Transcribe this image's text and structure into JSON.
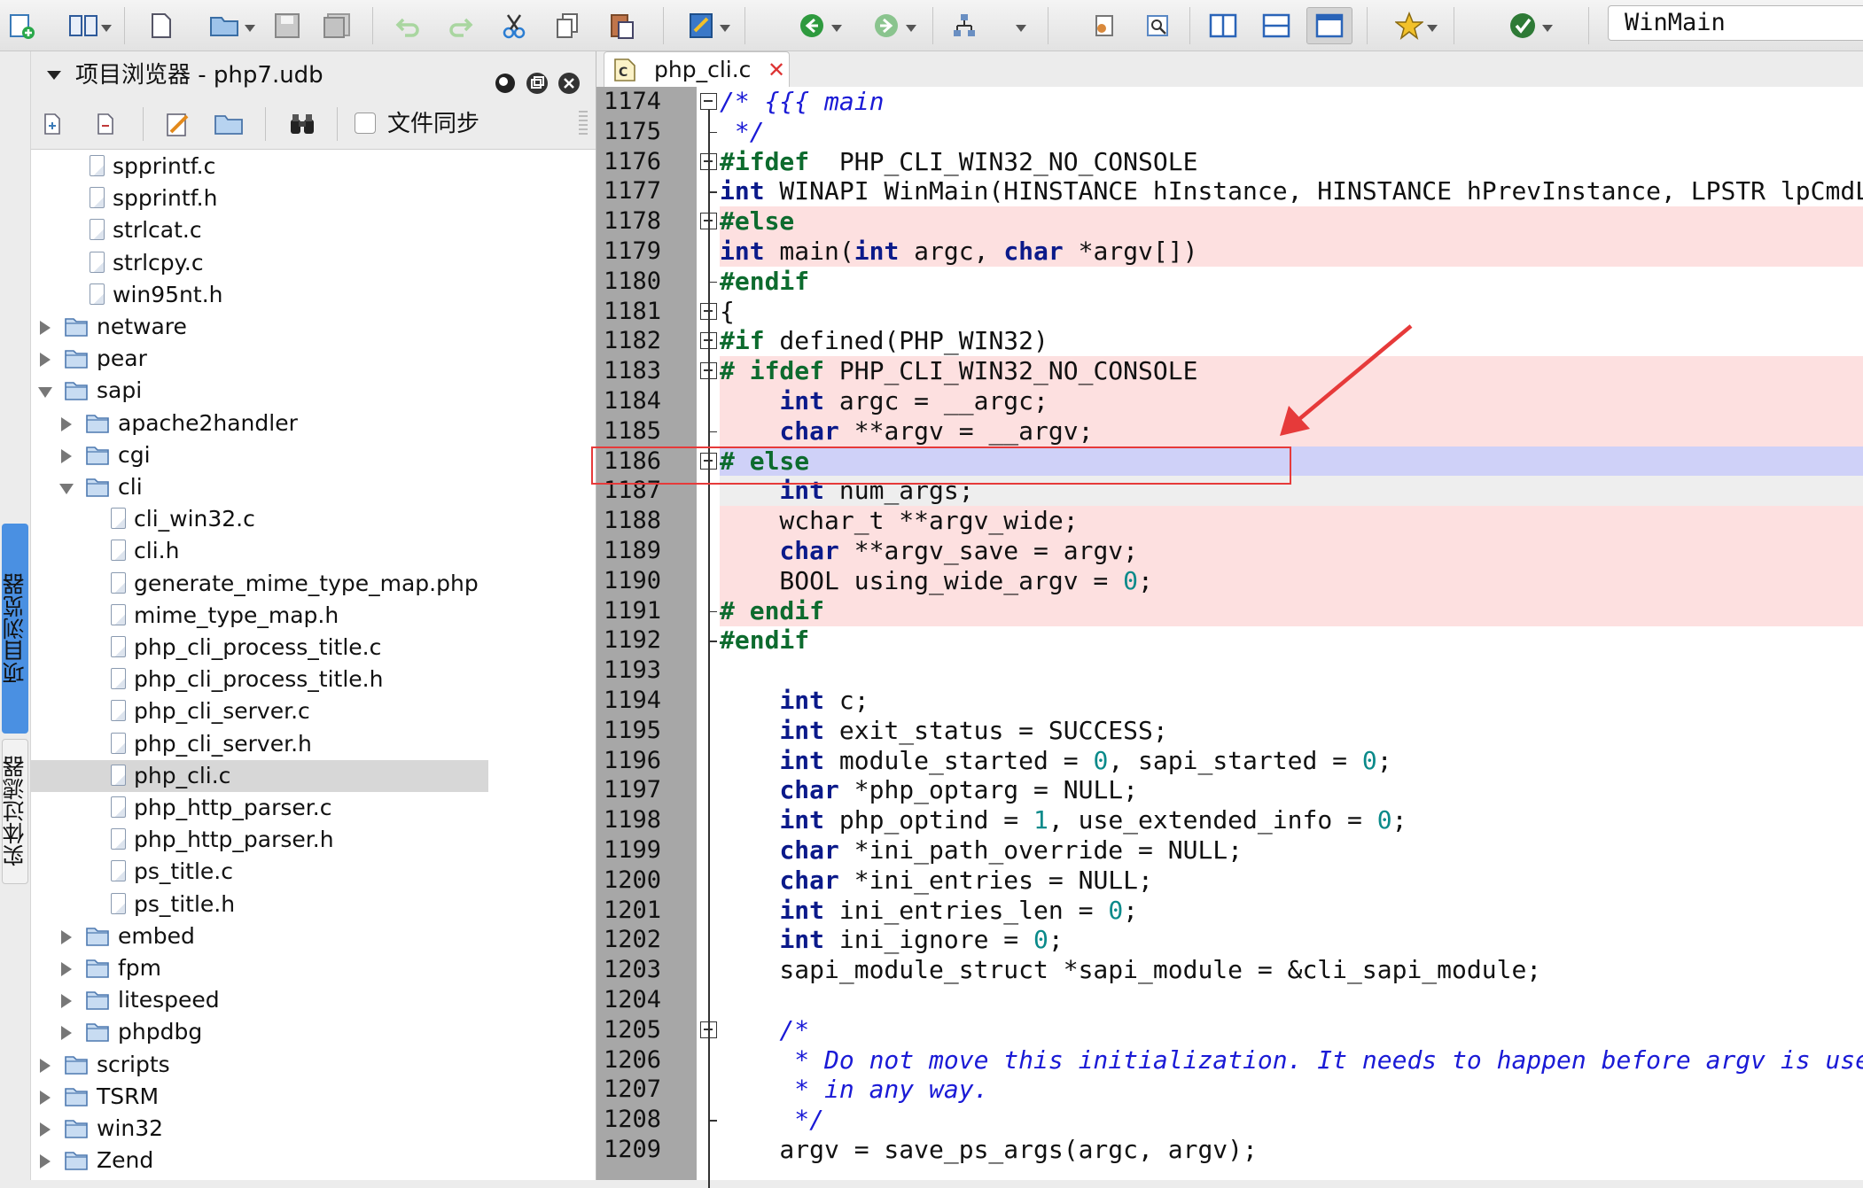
{
  "toolbar": {
    "search_value": "WinMain",
    "icons": [
      "add-icon",
      "book-icon",
      "new-file-icon",
      "open-folder-icon",
      "save-icon",
      "save-all-icon",
      "undo-icon",
      "redo-icon",
      "cut-icon",
      "copy-icon",
      "paste-icon",
      "edit-icon",
      "back-icon",
      "forward-icon",
      "hierarchy-icon",
      "settings-icon",
      "search-doc-icon",
      "split-vertical-icon",
      "split-horizontal-icon",
      "window-icon",
      "favorite-icon",
      "check-icon"
    ]
  },
  "side_tabs": {
    "project_browser": "项目浏览器",
    "entity_filter": "实体过滤器"
  },
  "panel": {
    "title": "项目浏览器 - php7.udb",
    "sync_label": "文件同步"
  },
  "tree": [
    {
      "label": "spprintf.c",
      "depth": 2,
      "kind": "file"
    },
    {
      "label": "spprintf.h",
      "depth": 2,
      "kind": "file"
    },
    {
      "label": "strlcat.c",
      "depth": 2,
      "kind": "file"
    },
    {
      "label": "strlcpy.c",
      "depth": 2,
      "kind": "file"
    },
    {
      "label": "win95nt.h",
      "depth": 2,
      "kind": "file"
    },
    {
      "label": "netware",
      "depth": 1,
      "kind": "folder",
      "state": "collapsed"
    },
    {
      "label": "pear",
      "depth": 1,
      "kind": "folder",
      "state": "collapsed"
    },
    {
      "label": "sapi",
      "depth": 1,
      "kind": "folder",
      "state": "expanded"
    },
    {
      "label": "apache2handler",
      "depth": 2,
      "kind": "folder",
      "state": "collapsed"
    },
    {
      "label": "cgi",
      "depth": 2,
      "kind": "folder",
      "state": "collapsed"
    },
    {
      "label": "cli",
      "depth": 2,
      "kind": "folder",
      "state": "expanded"
    },
    {
      "label": "cli_win32.c",
      "depth": 3,
      "kind": "file"
    },
    {
      "label": "cli.h",
      "depth": 3,
      "kind": "file"
    },
    {
      "label": "generate_mime_type_map.php",
      "depth": 3,
      "kind": "file"
    },
    {
      "label": "mime_type_map.h",
      "depth": 3,
      "kind": "file"
    },
    {
      "label": "php_cli_process_title.c",
      "depth": 3,
      "kind": "file"
    },
    {
      "label": "php_cli_process_title.h",
      "depth": 3,
      "kind": "file"
    },
    {
      "label": "php_cli_server.c",
      "depth": 3,
      "kind": "file"
    },
    {
      "label": "php_cli_server.h",
      "depth": 3,
      "kind": "file"
    },
    {
      "label": "php_cli.c",
      "depth": 3,
      "kind": "file",
      "selected": true
    },
    {
      "label": "php_http_parser.c",
      "depth": 3,
      "kind": "file"
    },
    {
      "label": "php_http_parser.h",
      "depth": 3,
      "kind": "file"
    },
    {
      "label": "ps_title.c",
      "depth": 3,
      "kind": "file"
    },
    {
      "label": "ps_title.h",
      "depth": 3,
      "kind": "file"
    },
    {
      "label": "embed",
      "depth": 2,
      "kind": "folder",
      "state": "collapsed"
    },
    {
      "label": "fpm",
      "depth": 2,
      "kind": "folder",
      "state": "collapsed"
    },
    {
      "label": "litespeed",
      "depth": 2,
      "kind": "folder",
      "state": "collapsed"
    },
    {
      "label": "phpdbg",
      "depth": 2,
      "kind": "folder",
      "state": "collapsed"
    },
    {
      "label": "scripts",
      "depth": 1,
      "kind": "folder",
      "state": "collapsed"
    },
    {
      "label": "TSRM",
      "depth": 1,
      "kind": "folder",
      "state": "collapsed"
    },
    {
      "label": "win32",
      "depth": 1,
      "kind": "folder",
      "state": "collapsed"
    },
    {
      "label": "Zend",
      "depth": 1,
      "kind": "folder",
      "state": "collapsed"
    }
  ],
  "editor": {
    "tab_label": "php_cli.c",
    "lines": [
      {
        "n": "1174",
        "bg": "",
        "fold": "box",
        "tokens": [
          [
            "cm",
            "/* {{{ main"
          ]
        ]
      },
      {
        "n": "1175",
        "bg": "",
        "fold": "end",
        "tokens": [
          [
            "cm",
            " */"
          ]
        ]
      },
      {
        "n": "1176",
        "bg": "",
        "fold": "box",
        "tokens": [
          [
            "pp",
            "#ifdef"
          ],
          [
            "",
            "  PHP_CLI_WIN32_NO_CONSOLE"
          ]
        ]
      },
      {
        "n": "1177",
        "bg": "",
        "fold": "end",
        "tokens": [
          [
            "kw",
            "int"
          ],
          [
            "",
            " WINAPI WinMain(HINSTANCE hInstance, HINSTANCE hPrevInstance, LPSTR lpCmdLine, int nShowCmd)"
          ]
        ]
      },
      {
        "n": "1178",
        "bg": "red",
        "fold": "box",
        "tokens": [
          [
            "pp",
            "#else"
          ]
        ]
      },
      {
        "n": "1179",
        "bg": "red",
        "fold": "line",
        "tokens": [
          [
            "kw",
            "int"
          ],
          [
            "",
            " main("
          ],
          [
            "kw",
            "int"
          ],
          [
            "",
            " argc, "
          ],
          [
            "kw",
            "char"
          ],
          [
            "",
            " *argv[])"
          ]
        ]
      },
      {
        "n": "1180",
        "bg": "",
        "fold": "end",
        "tokens": [
          [
            "pp",
            "#endif"
          ]
        ]
      },
      {
        "n": "1181",
        "bg": "",
        "fold": "box",
        "tokens": [
          [
            "",
            "{"
          ]
        ]
      },
      {
        "n": "1182",
        "bg": "",
        "fold": "box",
        "tokens": [
          [
            "pp",
            "#if"
          ],
          [
            "",
            " defined(PHP_WIN32)"
          ]
        ]
      },
      {
        "n": "1183",
        "bg": "red",
        "fold": "box",
        "tokens": [
          [
            "pp",
            "# ifdef"
          ],
          [
            "",
            " PHP_CLI_WIN32_NO_CONSOLE"
          ]
        ]
      },
      {
        "n": "1184",
        "bg": "red",
        "fold": "line",
        "tokens": [
          [
            "",
            "    "
          ],
          [
            "kw",
            "int"
          ],
          [
            "",
            " argc = __argc;"
          ]
        ]
      },
      {
        "n": "1185",
        "bg": "red",
        "fold": "end",
        "tokens": [
          [
            "",
            "    "
          ],
          [
            "kw",
            "char"
          ],
          [
            "",
            " **argv = __argv;"
          ]
        ]
      },
      {
        "n": "1186",
        "bg": "blue",
        "fold": "box",
        "tokens": [
          [
            "pp",
            "# else"
          ]
        ]
      },
      {
        "n": "1187",
        "bg": "grey",
        "fold": "line",
        "tokens": [
          [
            "",
            "    "
          ],
          [
            "kw",
            "int"
          ],
          [
            "",
            " num_args;"
          ]
        ]
      },
      {
        "n": "1188",
        "bg": "red",
        "fold": "line",
        "tokens": [
          [
            "",
            "    wchar_t **argv_wide;"
          ]
        ]
      },
      {
        "n": "1189",
        "bg": "red",
        "fold": "line",
        "tokens": [
          [
            "",
            "    "
          ],
          [
            "kw",
            "char"
          ],
          [
            "",
            " **argv_save = argv;"
          ]
        ]
      },
      {
        "n": "1190",
        "bg": "red",
        "fold": "line",
        "tokens": [
          [
            "",
            "    BOOL using_wide_argv = "
          ],
          [
            "num",
            "0"
          ],
          [
            "",
            ";"
          ]
        ]
      },
      {
        "n": "1191",
        "bg": "red",
        "fold": "end",
        "tokens": [
          [
            "pp",
            "# endif"
          ]
        ]
      },
      {
        "n": "1192",
        "bg": "",
        "fold": "end",
        "tokens": [
          [
            "pp",
            "#endif"
          ]
        ]
      },
      {
        "n": "1193",
        "bg": "",
        "fold": "line",
        "tokens": []
      },
      {
        "n": "1194",
        "bg": "",
        "fold": "line",
        "tokens": [
          [
            "",
            "    "
          ],
          [
            "kw",
            "int"
          ],
          [
            "",
            " c;"
          ]
        ]
      },
      {
        "n": "1195",
        "bg": "",
        "fold": "line",
        "tokens": [
          [
            "",
            "    "
          ],
          [
            "kw",
            "int"
          ],
          [
            "",
            " exit_status = SUCCESS;"
          ]
        ]
      },
      {
        "n": "1196",
        "bg": "",
        "fold": "line",
        "tokens": [
          [
            "",
            "    "
          ],
          [
            "kw",
            "int"
          ],
          [
            "",
            " module_started = "
          ],
          [
            "num",
            "0"
          ],
          [
            "",
            ", sapi_started = "
          ],
          [
            "num",
            "0"
          ],
          [
            "",
            ";"
          ]
        ]
      },
      {
        "n": "1197",
        "bg": "",
        "fold": "line",
        "tokens": [
          [
            "",
            "    "
          ],
          [
            "kw",
            "char"
          ],
          [
            "",
            " *php_optarg = NULL;"
          ]
        ]
      },
      {
        "n": "1198",
        "bg": "",
        "fold": "line",
        "tokens": [
          [
            "",
            "    "
          ],
          [
            "kw",
            "int"
          ],
          [
            "",
            " php_optind = "
          ],
          [
            "num",
            "1"
          ],
          [
            "",
            ", use_extended_info = "
          ],
          [
            "num",
            "0"
          ],
          [
            "",
            ";"
          ]
        ]
      },
      {
        "n": "1199",
        "bg": "",
        "fold": "line",
        "tokens": [
          [
            "",
            "    "
          ],
          [
            "kw",
            "char"
          ],
          [
            "",
            " *ini_path_override = NULL;"
          ]
        ]
      },
      {
        "n": "1200",
        "bg": "",
        "fold": "line",
        "tokens": [
          [
            "",
            "    "
          ],
          [
            "kw",
            "char"
          ],
          [
            "",
            " *ini_entries = NULL;"
          ]
        ]
      },
      {
        "n": "1201",
        "bg": "",
        "fold": "line",
        "tokens": [
          [
            "",
            "    "
          ],
          [
            "kw",
            "int"
          ],
          [
            "",
            " ini_entries_len = "
          ],
          [
            "num",
            "0"
          ],
          [
            "",
            ";"
          ]
        ]
      },
      {
        "n": "1202",
        "bg": "",
        "fold": "line",
        "tokens": [
          [
            "",
            "    "
          ],
          [
            "kw",
            "int"
          ],
          [
            "",
            " ini_ignore = "
          ],
          [
            "num",
            "0"
          ],
          [
            "",
            ";"
          ]
        ]
      },
      {
        "n": "1203",
        "bg": "",
        "fold": "line",
        "tokens": [
          [
            "",
            "    sapi_module_struct *sapi_module = &cli_sapi_module;"
          ]
        ]
      },
      {
        "n": "1204",
        "bg": "",
        "fold": "line",
        "tokens": []
      },
      {
        "n": "1205",
        "bg": "",
        "fold": "box",
        "tokens": [
          [
            "cm",
            "    /*"
          ]
        ]
      },
      {
        "n": "1206",
        "bg": "",
        "fold": "line",
        "tokens": [
          [
            "cm",
            "     * Do not move this initialization. It needs to happen before argv is used"
          ]
        ]
      },
      {
        "n": "1207",
        "bg": "",
        "fold": "line",
        "tokens": [
          [
            "cm",
            "     * in any way."
          ]
        ]
      },
      {
        "n": "1208",
        "bg": "",
        "fold": "end",
        "tokens": [
          [
            "cm",
            "     */"
          ]
        ]
      },
      {
        "n": "1209",
        "bg": "",
        "fold": "line",
        "tokens": [
          [
            "",
            "    argv = save_ps_args(argc, argv);"
          ]
        ]
      }
    ]
  },
  "colors": {
    "accent_tab": "#4a90e2",
    "highlight_red": "#fde0e0",
    "highlight_blue": "#cfd1f8",
    "keyword": "#0b1a8a",
    "preprocessor": "#0d6b2e",
    "comment": "#1a1ad6",
    "annotation": "#e63a3a"
  }
}
